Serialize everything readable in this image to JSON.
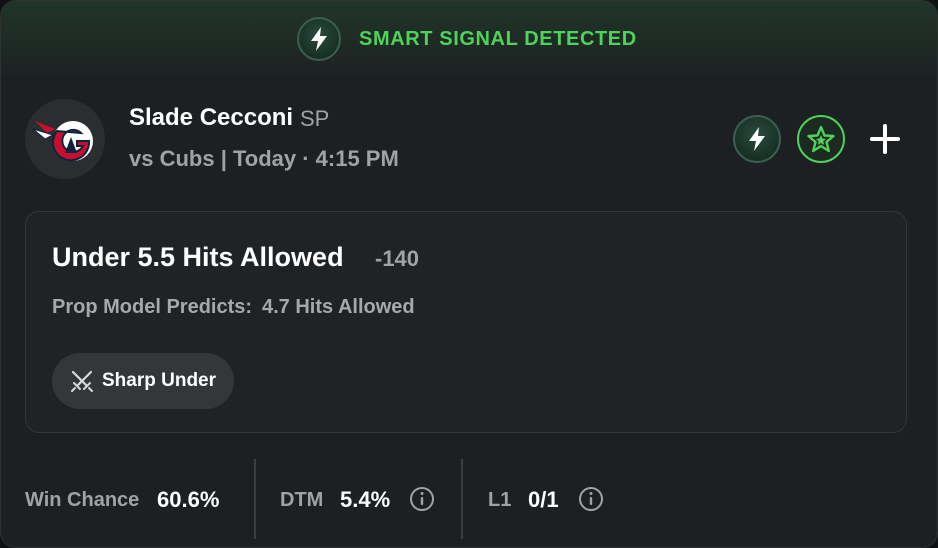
{
  "banner": {
    "text": "SMART SIGNAL DETECTED",
    "icon": "lightning-bolt-icon"
  },
  "player": {
    "name": "Slade Cecconi",
    "position": "SP",
    "game_info": "vs Cubs | Today · 4:15 PM",
    "team_logo": "guardians-logo"
  },
  "actions": [
    {
      "icon": "lightning-bolt-icon"
    },
    {
      "icon": "star-icon"
    },
    {
      "icon": "plus-icon"
    }
  ],
  "prop": {
    "title": "Under 5.5 Hits Allowed",
    "odds": "-140",
    "model_label": "Prop Model Predicts:",
    "model_value": "4.7 Hits Allowed",
    "tag_label": "Sharp Under",
    "tag_icon": "crossed-swords-icon"
  },
  "stats": [
    {
      "label": "Win Chance",
      "value": "60.6%"
    },
    {
      "label": "DTM",
      "value": "5.4%",
      "info_icon": true
    },
    {
      "label": "L1",
      "value": "0/1",
      "info_icon": true
    }
  ],
  "colors": {
    "accent_green": "#4fd25a",
    "card_bg": "#1d2022",
    "muted_text": "#9fa3a6"
  }
}
